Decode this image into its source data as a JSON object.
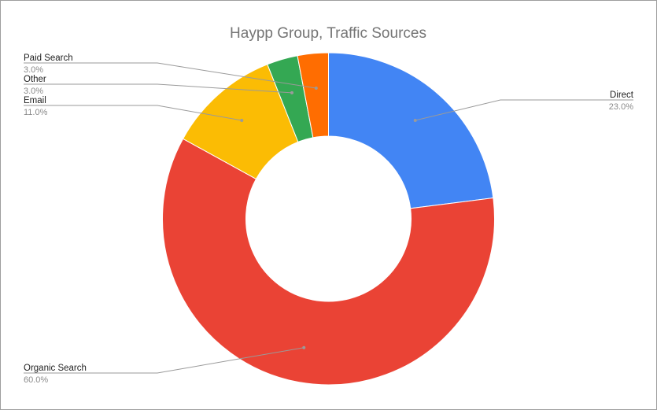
{
  "chart_data": {
    "type": "pie",
    "title": "Haypp Group, Traffic Sources",
    "donut": true,
    "legend": "labels-with-leader-lines",
    "slices": [
      {
        "label": "Direct",
        "value": 23.0,
        "pct_label": "23.0%",
        "color": "#4285f4"
      },
      {
        "label": "Organic Search",
        "value": 60.0,
        "pct_label": "60.0%",
        "color": "#ea4335"
      },
      {
        "label": "Email",
        "value": 11.0,
        "pct_label": "11.0%",
        "color": "#fbbc04"
      },
      {
        "label": "Other",
        "value": 3.0,
        "pct_label": "3.0%",
        "color": "#34a853"
      },
      {
        "label": "Paid Search",
        "value": 3.0,
        "pct_label": "3.0%",
        "color": "#ff6d01"
      }
    ]
  }
}
